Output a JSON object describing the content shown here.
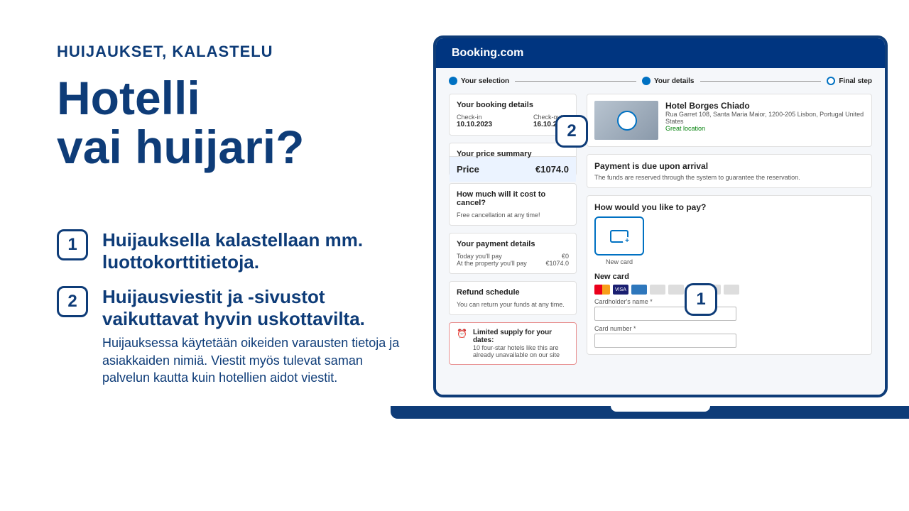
{
  "left": {
    "eyebrow": "HUIJAUKSET, KALASTELU",
    "headline": "Hotelli\nvai huijari?",
    "points": [
      {
        "num": "1",
        "title": "Huijauksella kalastellaan mm. luottokorttitietoja."
      },
      {
        "num": "2",
        "title": "Huijausviestit ja -sivustot vaikuttavat hyvin uskottavilta.",
        "body": "Huijauksessa käytetään oikeiden varausten tietoja ja asiakkaiden nimiä. Viestit myös tulevat saman palvelun kautta kuin hotellien aidot viestit."
      }
    ]
  },
  "booking": {
    "brand": "Booking.com",
    "steps": {
      "s1": "Your selection",
      "s2": "Your details",
      "s3": "Final step"
    },
    "details": {
      "heading": "Your booking details",
      "checkin_label": "Check-in",
      "checkin": "10.10.2023",
      "checkout_label": "Check-out",
      "checkout": "16.10.2023"
    },
    "price_summary": {
      "heading": "Your price summary",
      "price_label": "Price",
      "price": "€1074.0"
    },
    "cancel": {
      "heading": "How much will it cost to cancel?",
      "text": "Free cancellation at any time!"
    },
    "payment_details": {
      "heading": "Your payment details",
      "today_label": "Today you'll pay",
      "today": "€0",
      "property_label": "At the property you'll pay",
      "property": "€1074.0"
    },
    "refund": {
      "heading": "Refund schedule",
      "text": "You can return your funds at any time."
    },
    "alert": {
      "title": "Limited supply for your dates:",
      "text": "10 four-star hotels like this are already unavailable on our site"
    },
    "hotel": {
      "name": "Hotel Borges Chiado",
      "address": "Rua Garret 108, Santa Maria Maior, 1200-205 Lisbon, Portugal United States",
      "tag": "Great location"
    },
    "due": {
      "heading": "Payment is due upon arrival",
      "text": "The funds are reserved through the system to guarantee the reservation."
    },
    "pay": {
      "heading": "How would you like to pay?",
      "newcard": "New card",
      "newcard_h": "New card",
      "cardholder_label": "Cardholder's name *",
      "cardnumber_label": "Card number *"
    }
  },
  "callouts": {
    "c1": "1",
    "c2": "2"
  }
}
